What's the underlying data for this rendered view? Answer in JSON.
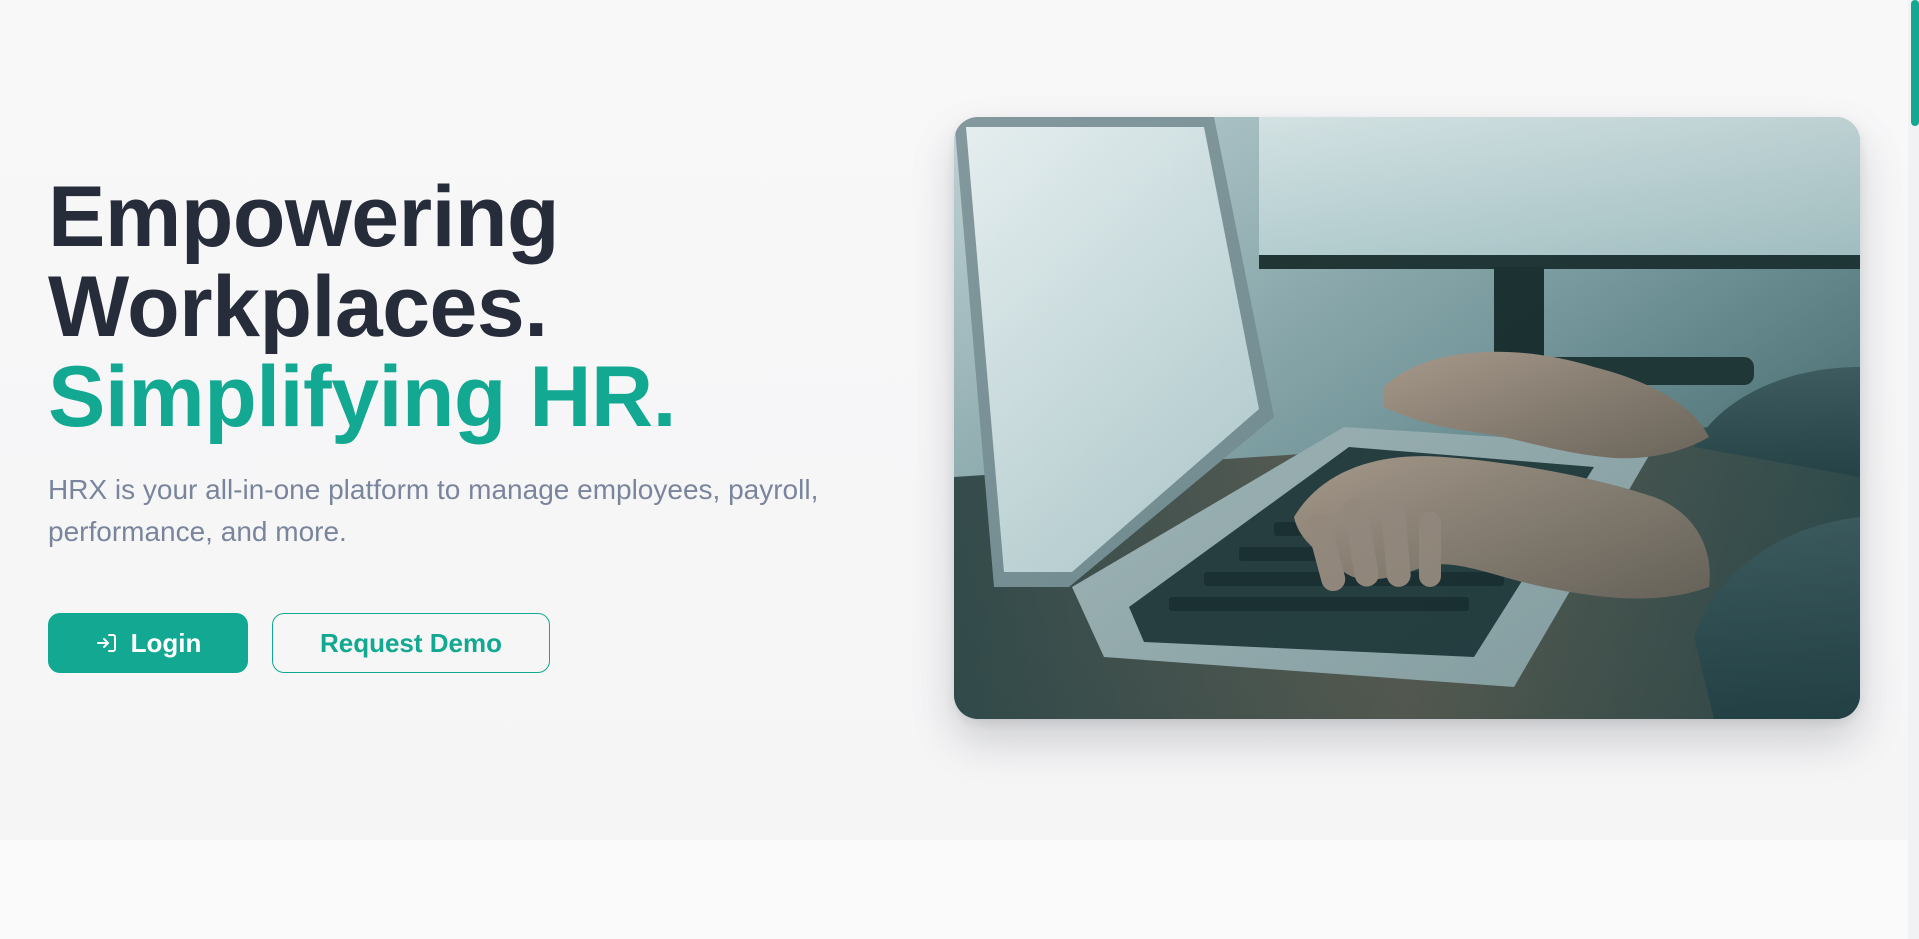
{
  "hero": {
    "headline_line1": "Empowering",
    "headline_line2": "Workplaces.",
    "headline_accent": "Simplifying HR.",
    "subtitle": "HRX is your all-in-one platform to manage employees, payroll, performance, and more.",
    "login_label": "Login",
    "login_icon": "login-arrow-icon",
    "demo_label": "Request Demo",
    "image_alt": "hands-typing-on-laptop-photo"
  },
  "colors": {
    "accent": "#12a892",
    "heading": "#262c3a",
    "subtext": "#7a859d",
    "background": "#f8f9fa"
  }
}
